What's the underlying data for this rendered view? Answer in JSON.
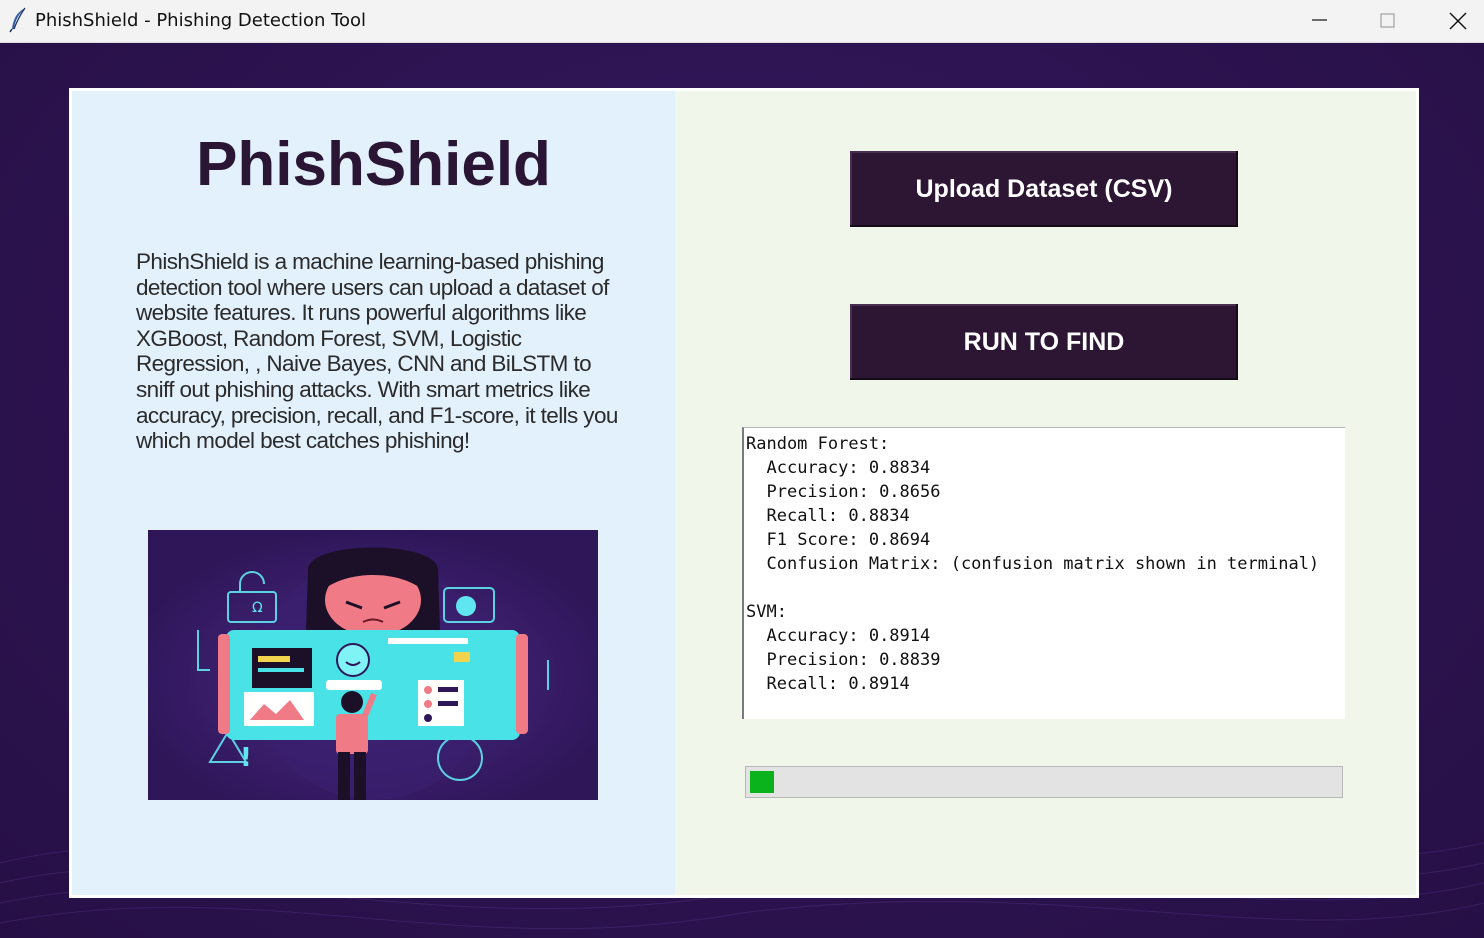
{
  "window": {
    "title": "PhishShield - Phishing Detection Tool"
  },
  "left": {
    "brand_title": "PhishShield",
    "description": "PhishShield is a machine learning-based phishing detection tool where users can upload a dataset of website features. It runs powerful algorithms like XGBoost, Random Forest, SVM, Logistic Regression, , Naive Bayes, CNN and BiLSTM to sniff out phishing attacks. With smart metrics like accuracy, precision, recall, and F1-score, it tells you which model best catches phishing!"
  },
  "right": {
    "upload_label": "Upload Dataset (CSV)",
    "run_label": "RUN TO FIND",
    "results_text": "Random Forest:\n  Accuracy: 0.8834\n  Precision: 0.8656\n  Recall: 0.8834\n  F1 Score: 0.8694\n  Confusion Matrix: (confusion matrix shown in terminal)\n\nSVM:\n  Accuracy: 0.8914\n  Precision: 0.8839\n  Recall: 0.8914",
    "progress_fraction": 0.04
  },
  "colors": {
    "accent_button": "#2d1633",
    "progress_fill": "#0ab21b",
    "backdrop": "#2f1553"
  },
  "icons": {
    "app": "feather-icon",
    "minimize": "minimize-icon",
    "maximize": "maximize-icon",
    "close": "close-icon"
  }
}
